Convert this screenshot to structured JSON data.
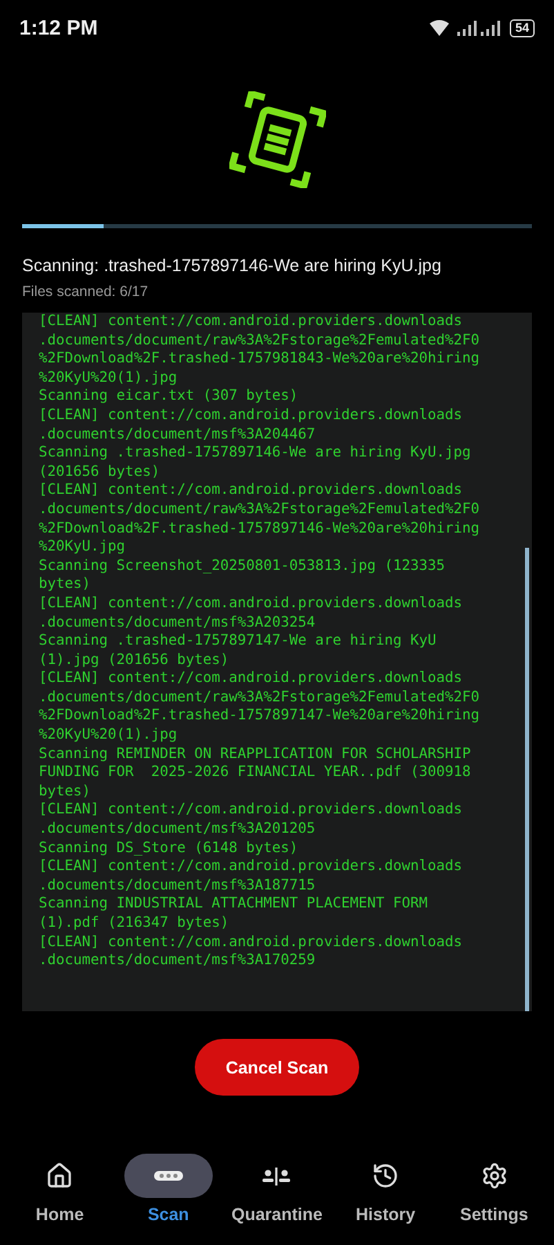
{
  "status_bar": {
    "time": "1:12 PM",
    "battery": "54"
  },
  "progress": {
    "level": 0.16
  },
  "current_file": "Scanning: .trashed-1757897146-We are hiring KyU.jpg",
  "files_scanned": "Files scanned: 6/17",
  "log": [
    "[CLEAN] content://com.android.providers.downloads",
    ".documents/document/raw%3A%2Fstorage%2Femulated%2F0",
    "%2FDownload%2F.trashed-1757981843-We%20are%20hiring",
    "%20KyU%20(1).jpg",
    "Scanning eicar.txt (307 bytes)",
    "[CLEAN] content://com.android.providers.downloads",
    ".documents/document/msf%3A204467",
    "Scanning .trashed-1757897146-We are hiring KyU.jpg",
    "(201656 bytes)",
    "[CLEAN] content://com.android.providers.downloads",
    ".documents/document/raw%3A%2Fstorage%2Femulated%2F0",
    "%2FDownload%2F.trashed-1757897146-We%20are%20hiring",
    "%20KyU.jpg",
    "Scanning Screenshot_20250801-053813.jpg (123335",
    "bytes)",
    "[CLEAN] content://com.android.providers.downloads",
    ".documents/document/msf%3A203254",
    "Scanning .trashed-1757897147-We are hiring KyU",
    "(1).jpg (201656 bytes)",
    "[CLEAN] content://com.android.providers.downloads",
    ".documents/document/raw%3A%2Fstorage%2Femulated%2F0",
    "%2FDownload%2F.trashed-1757897147-We%20are%20hiring",
    "%20KyU%20(1).jpg",
    "Scanning REMINDER ON REAPPLICATION FOR SCHOLARSHIP",
    "FUNDING FOR  2025-2026 FINANCIAL YEAR..pdf (300918",
    "bytes)",
    "[CLEAN] content://com.android.providers.downloads",
    ".documents/document/msf%3A201205",
    "Scanning DS_Store (6148 bytes)",
    "[CLEAN] content://com.android.providers.downloads",
    ".documents/document/msf%3A187715",
    "Scanning INDUSTRIAL ATTACHMENT PLACEMENT FORM",
    "(1).pdf (216347 bytes)",
    "[CLEAN] content://com.android.providers.downloads",
    ".documents/document/msf%3A170259"
  ],
  "cancel_button": "Cancel Scan",
  "nav": [
    {
      "kind": "home",
      "label": "Home",
      "selected": false
    },
    {
      "kind": "scan",
      "label": "Scan",
      "selected": true
    },
    {
      "kind": "quarantine",
      "label": "Quarantine",
      "selected": false
    },
    {
      "kind": "history",
      "label": "History",
      "selected": false
    },
    {
      "kind": "settings",
      "label": "Settings",
      "selected": false
    }
  ]
}
